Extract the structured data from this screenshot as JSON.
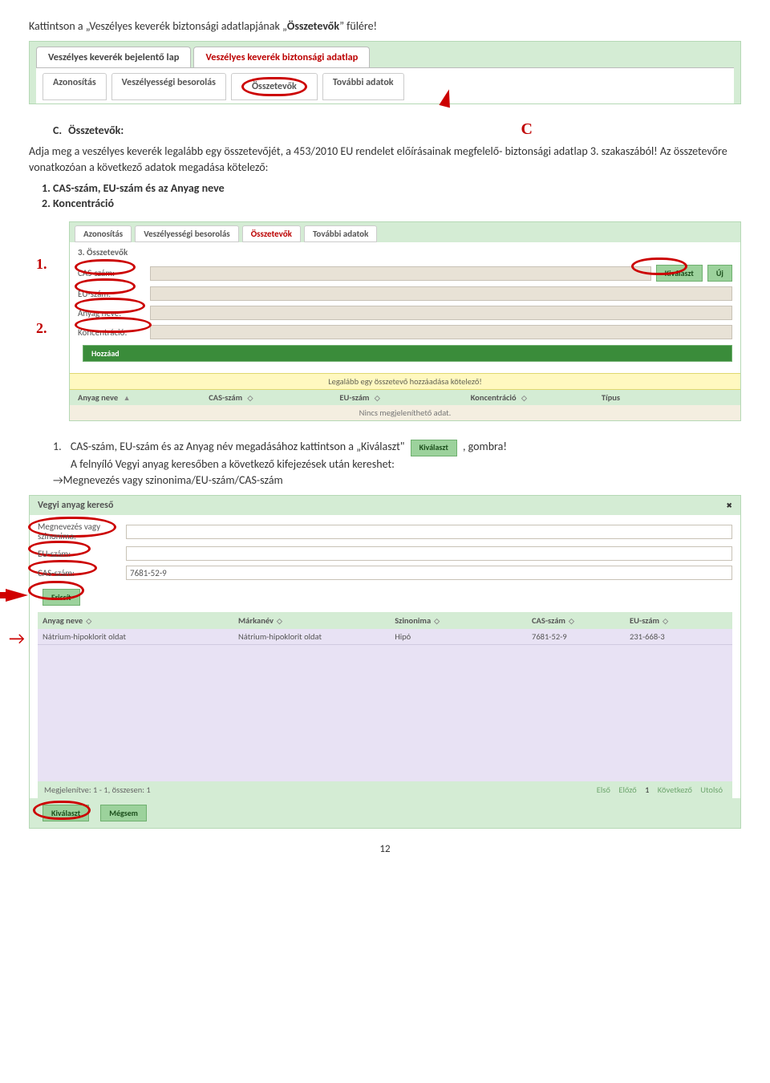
{
  "intro": {
    "pre": "Kattintson a „Veszélyes keverék biztonsági adatlapjának „",
    "emph": "Összetevők",
    "post": "” fülére!"
  },
  "panel1": {
    "tab1": "Veszélyes keverék bejelentő lap",
    "tab2": "Veszélyes keverék biztonsági adatlap",
    "subtabs": {
      "a": "Azonosítás",
      "b": "Veszélyességi besorolás",
      "c": "Összetevők",
      "d": "További adatok"
    }
  },
  "sectionC": {
    "marker": "C",
    "letter": "C.",
    "title": "Összetevők:",
    "para": "Adja meg a veszélyes keverék legalább egy összetevőjét, a 453/2010 EU rendelet előírásainak megfelelő- biztonsági adatlap 3. szakaszából! Az összetevőre vonatkozóan a következő adatok megadása kötelező:",
    "li1": "CAS-szám, EU-szám és az Anyag neve",
    "li2": "Koncentráció"
  },
  "side": {
    "one": "1.",
    "two": "2."
  },
  "ss2": {
    "tabs": {
      "a": "Azonosítás",
      "b": "Veszélyességi besorolás",
      "c": "Összetevők",
      "d": "További adatok"
    },
    "section": "3. Összetevők",
    "labels": {
      "cas": "CAS-szám:",
      "eu": "EU-szám:",
      "anyag": "Anyag neve:",
      "konc": "Koncentráció:"
    },
    "buttons": {
      "kivalaszt": "Kiválaszt",
      "uj": "Új",
      "hozzaad": "Hozzáad"
    },
    "warn": "Legalább egy összetevő hozzáadása kötelező!",
    "headers": {
      "anyag": "Anyag neve",
      "cas": "CAS-szám",
      "eu": "EU-szám",
      "konc": "Koncentráció",
      "tipus": "Típus"
    },
    "nodata": "Nincs megjeleníthető adat."
  },
  "instr1": {
    "num": "1.",
    "pre": "CAS-szám, EU-szám és az Anyag név",
    "mid": " megadásához kattintson a „",
    "kiv": "Kiválaszt",
    "btn": "Kiválaszt",
    "post": ", gombra!",
    "line2a": "A felnyíló ",
    "line2b": "Vegyi anyag keresőben",
    "line2c": " a következő kifejezések után kereshet:",
    "line3": "→Megnevezés vagy szinonima/EU-szám/CAS-szám"
  },
  "panel3": {
    "title": "Vegyi anyag kereső",
    "close": "✖",
    "labels": {
      "meg": "Megnevezés vagy szinonima:",
      "eu": "EU-szám:",
      "cas": "CAS-szám:"
    },
    "cas_value": "7681-52-9",
    "frissit": "Frissít",
    "headers": {
      "anyag": "Anyag neve",
      "mark": "Márkanév",
      "szin": "Szinonima",
      "cas": "CAS-szám",
      "eu": "EU-szám"
    },
    "row1": {
      "anyag": "Nátrium-hipoklorit oldat",
      "mark": "Nátrium-hipoklorit oldat",
      "szin": "Hipó",
      "cas": "7681-52-9",
      "eu": "231-668-3"
    },
    "footer_left": "Megjelenítve: 1 - 1, összesen: 1",
    "navs": {
      "elso": "Első",
      "elozo": "Előző",
      "num": "1",
      "kov": "Következő",
      "utolso": "Utolsó"
    },
    "footer_btns": {
      "kivalaszt": "Kiválaszt",
      "megsem": "Mégsem"
    }
  },
  "pagenum": "12"
}
